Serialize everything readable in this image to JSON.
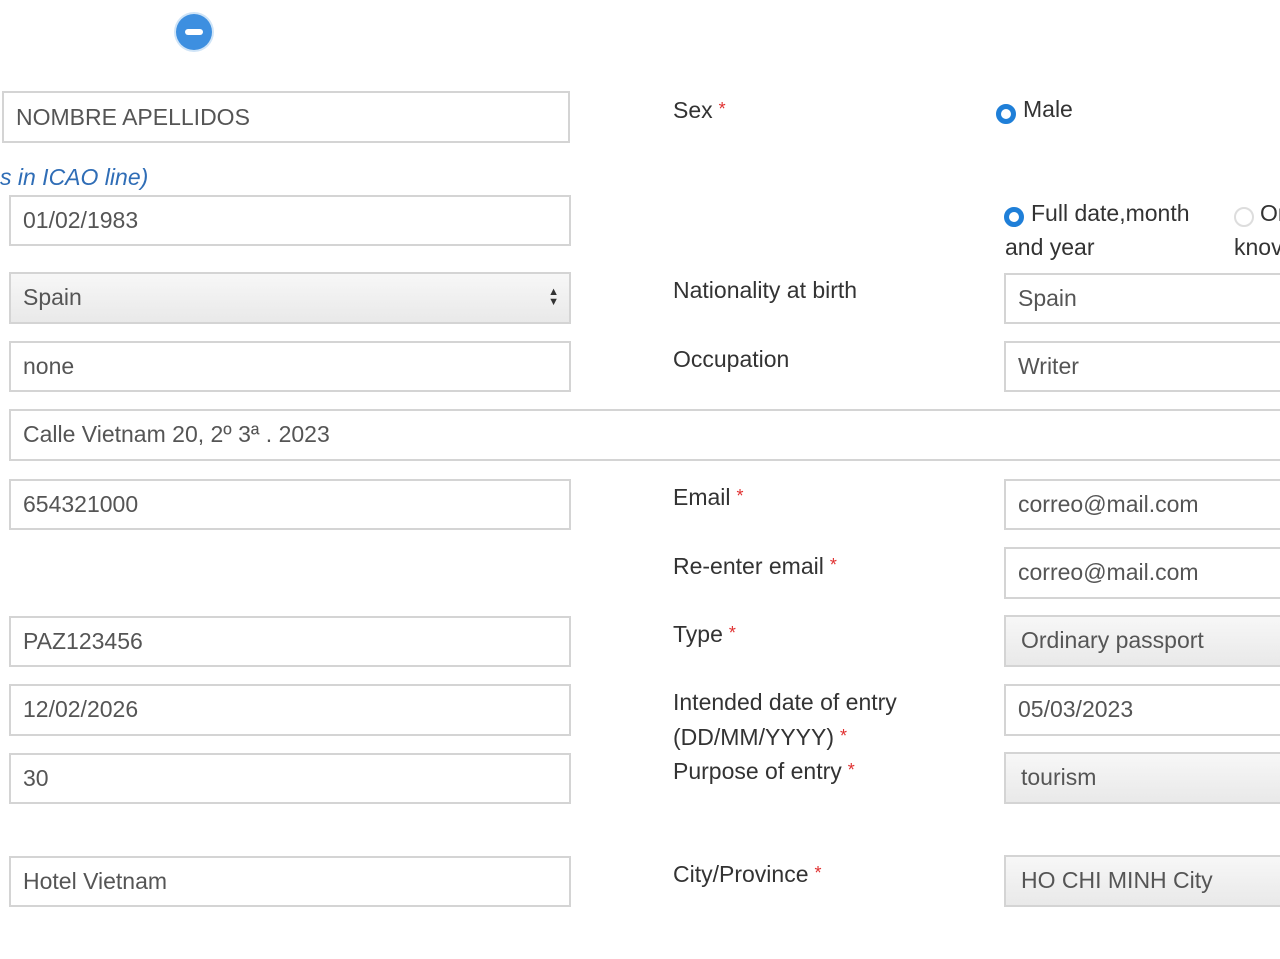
{
  "form": {
    "full_name": "NOMBRE APELLIDOS",
    "icao_note": "s in ICAO line)",
    "date_of_birth": "01/02/1983",
    "nationality": "Spain",
    "other_nationality": "none",
    "address": "Calle Vietnam 20, 2º 3ª . 2023",
    "phone": "654321000",
    "passport_number": "PAZ123456",
    "passport_expiry": "12/02/2026",
    "duration": "30",
    "accommodation": "Hotel Vietnam"
  },
  "right": {
    "sex_label": "Sex",
    "sex_option_male": "Male",
    "dob_option_full_line1": "Full date,month",
    "dob_option_full_line2": "and year",
    "dob_option_other_line1": "On",
    "dob_option_other_line2": "knov",
    "nationality_at_birth_label": "Nationality at birth",
    "nationality_at_birth": "Spain",
    "occupation_label": "Occupation",
    "occupation": "Writer",
    "email_label": "Email",
    "email": "correo@mail.com",
    "reenter_email_label": "Re-enter email",
    "reenter_email": "correo@mail.com",
    "type_label": "Type",
    "type": "Ordinary passport",
    "entry_date_label_line1": "Intended date of entry",
    "entry_date_label_line2": "(DD/MM/YYYY)",
    "entry_date": "05/03/2023",
    "purpose_label": "Purpose of entry",
    "purpose": "tourism",
    "city_label": "City/Province",
    "city": "HO CHI MINH City"
  },
  "required_mark": "*",
  "colors": {
    "accent": "#1f7fd8",
    "required": "#e03030",
    "note": "#2f6db6"
  },
  "icons": {
    "remove": "minus-circle-icon",
    "select": "select-arrows-icon"
  }
}
